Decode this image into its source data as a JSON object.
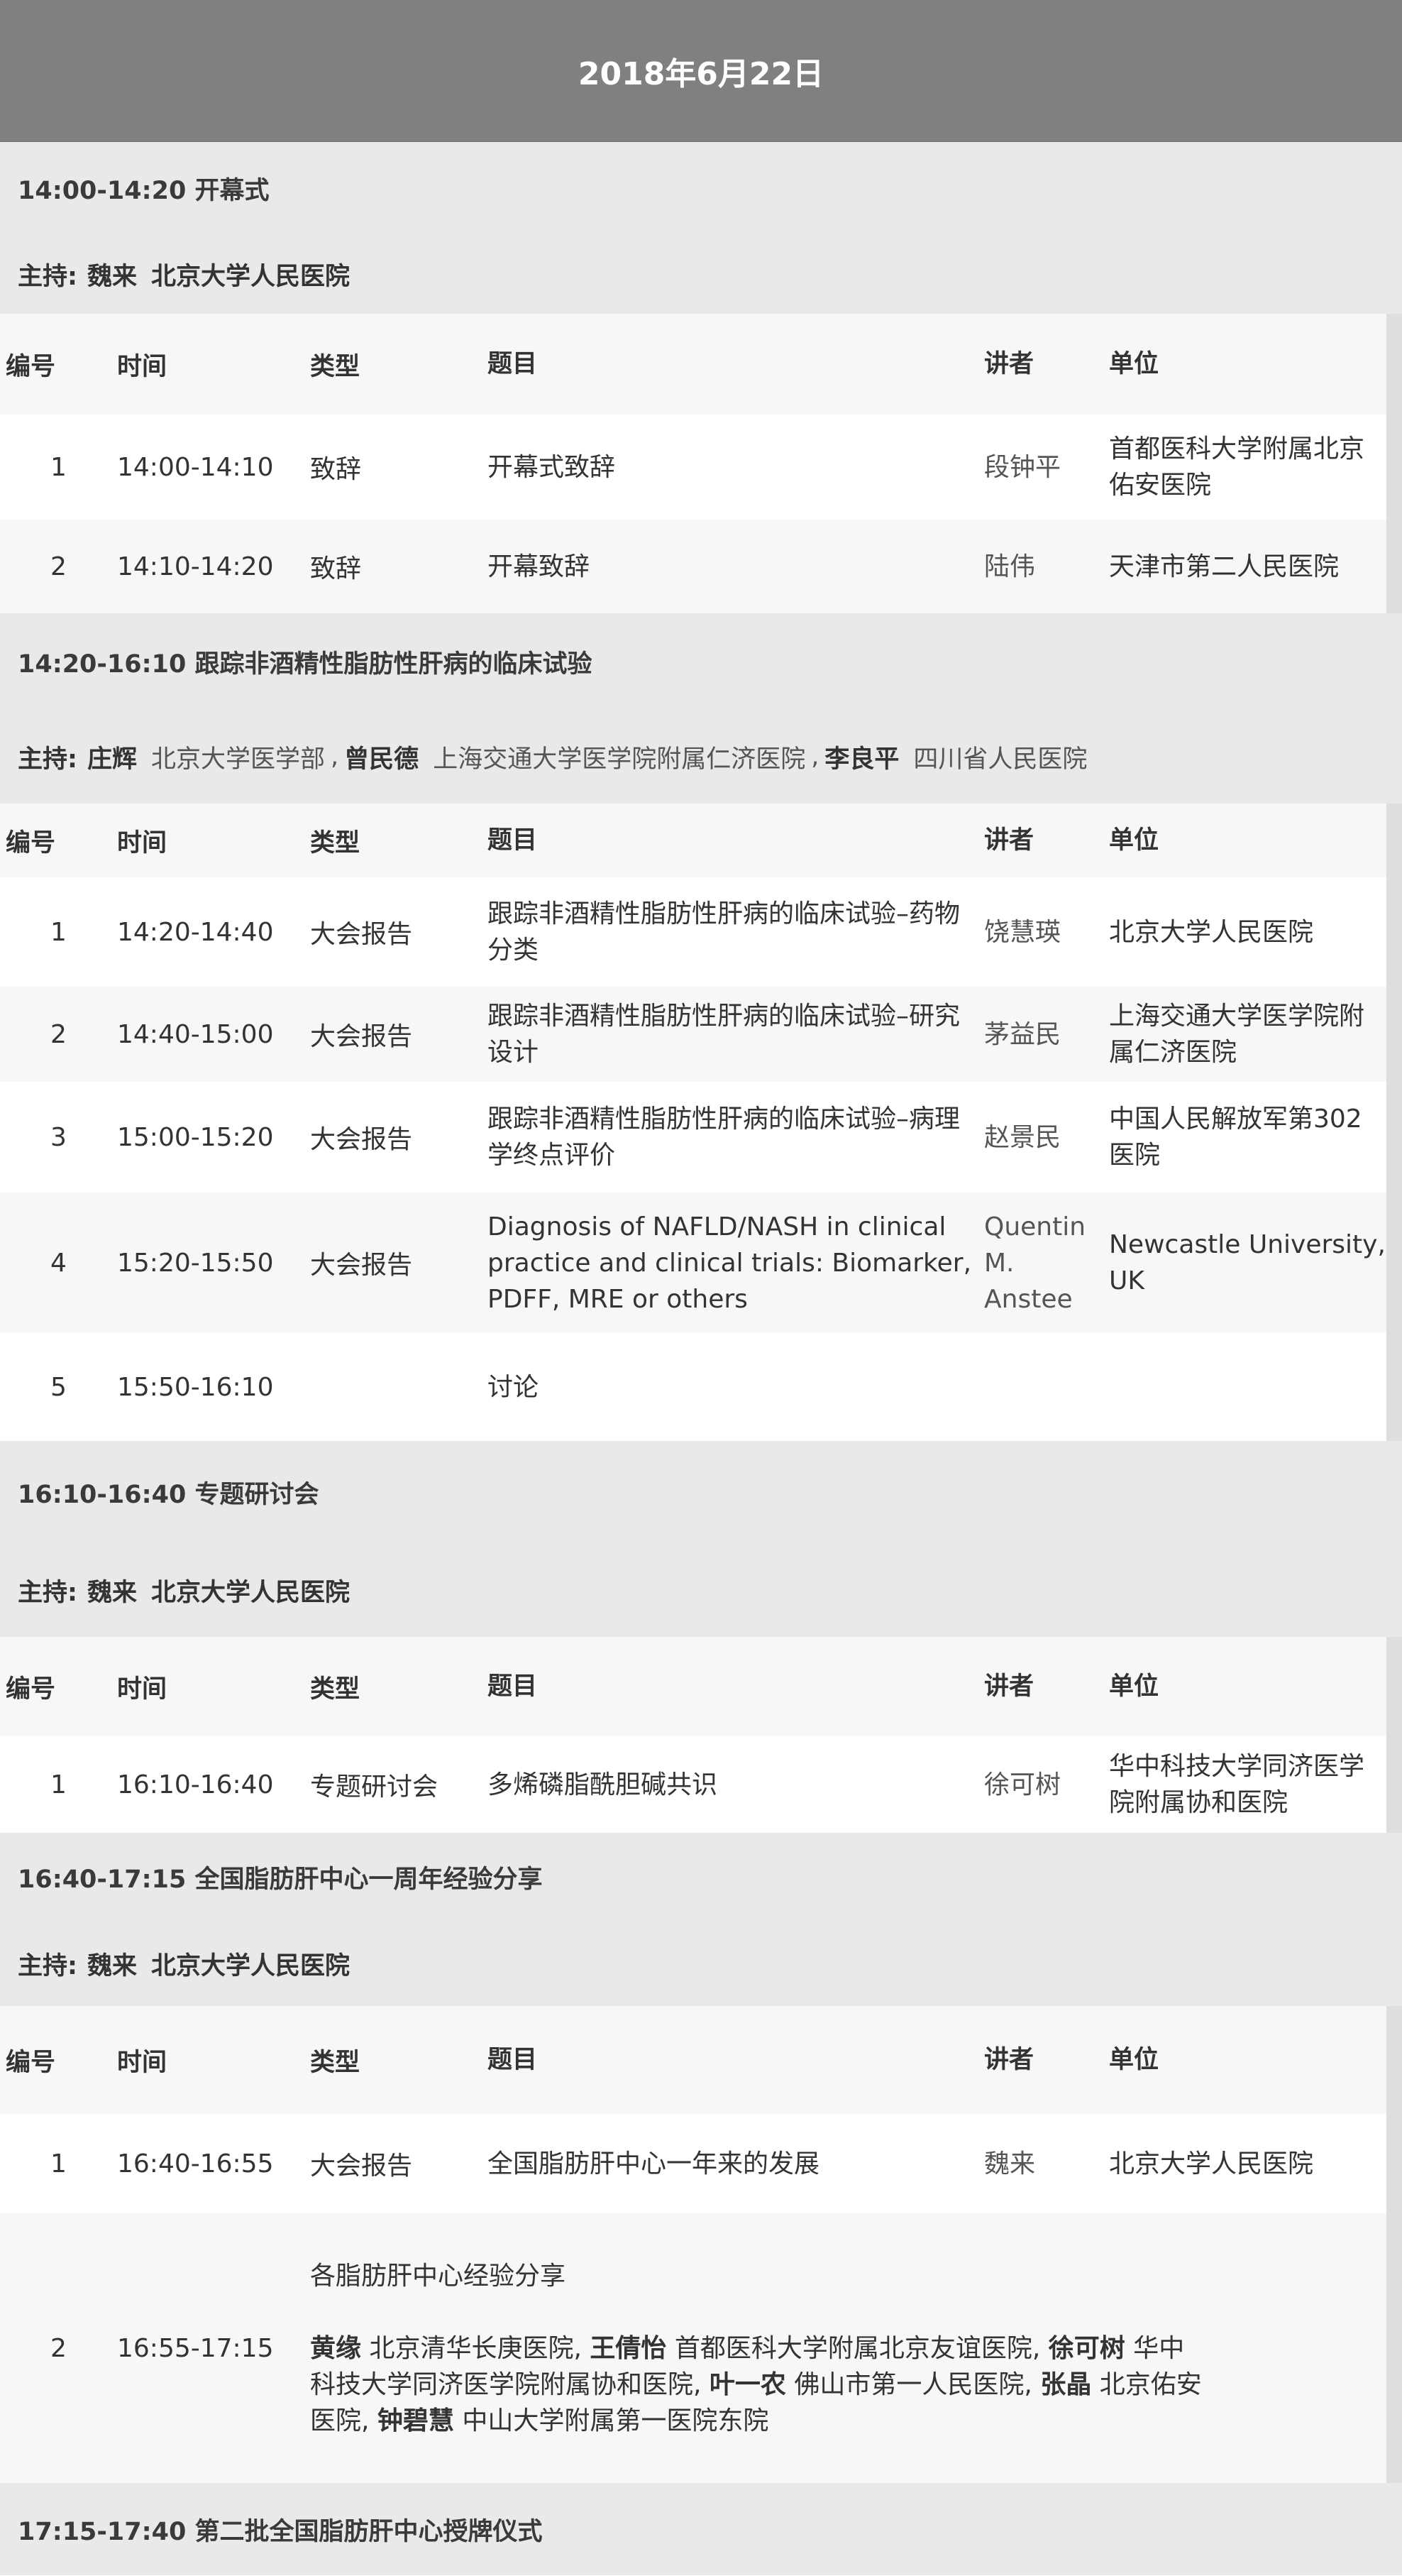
{
  "header": {
    "date": "2018年6月22日"
  },
  "columns": {
    "no": "编号",
    "time": "时间",
    "type": "类型",
    "title": "题目",
    "speaker": "讲者",
    "unit": "单位"
  },
  "sessions": [
    {
      "heading": "14:00-14:20 开幕式",
      "host_prefix": "主持:",
      "hosts": [
        {
          "name": "魏来",
          "unit": "北京大学人民医院"
        }
      ],
      "rows": [
        {
          "no": "1",
          "time": "14:00-14:10",
          "type": "致辞",
          "title": "开幕式致辞",
          "speaker": "段钟平",
          "unit": "首都医科大学附属北京佑安医院"
        },
        {
          "no": "2",
          "time": "14:10-14:20",
          "type": "致辞",
          "title": "开幕致辞",
          "speaker": "陆伟",
          "unit": "天津市第二人民医院"
        }
      ]
    },
    {
      "heading": "14:20-16:10 跟踪非酒精性脂肪性肝病的临床试验",
      "host_prefix": "主持:",
      "hosts": [
        {
          "name": "庄辉",
          "unit": "北京大学医学部"
        },
        {
          "name": "曾民德",
          "unit": "上海交通大学医学院附属仁济医院"
        },
        {
          "name": "李良平",
          "unit": "四川省人民医院"
        }
      ],
      "host_separator": ",",
      "rows": [
        {
          "no": "1",
          "time": "14:20-14:40",
          "type": "大会报告",
          "title": "跟踪非酒精性脂肪性肝病的临床试验–药物分类",
          "speaker": "饶慧瑛",
          "unit": "北京大学人民医院"
        },
        {
          "no": "2",
          "time": "14:40-15:00",
          "type": "大会报告",
          "title": "跟踪非酒精性脂肪性肝病的临床试验–研究设计",
          "speaker": "茅益民",
          "unit": "上海交通大学医学院附属仁济医院"
        },
        {
          "no": "3",
          "time": "15:00-15:20",
          "type": "大会报告",
          "title": "跟踪非酒精性脂肪性肝病的临床试验–病理学终点评价",
          "speaker": "赵景民",
          "unit": "中国人民解放军第302医院"
        },
        {
          "no": "4",
          "time": "15:20-15:50",
          "type": "大会报告",
          "title": "Diagnosis of NAFLD/NASH in clinical practice and clinical trials: Biomarker, PDFF, MRE or others",
          "speaker": "Quentin M. Anstee",
          "unit": "Newcastle University, UK"
        },
        {
          "no": "5",
          "time": "15:50-16:10",
          "type": "",
          "title": "讨论",
          "speaker": "",
          "unit": ""
        }
      ]
    },
    {
      "heading": "16:10-16:40 专题研讨会",
      "host_prefix": "主持:",
      "hosts": [
        {
          "name": "魏来",
          "unit": "北京大学人民医院"
        }
      ],
      "rows": [
        {
          "no": "1",
          "time": "16:10-16:40",
          "type": "专题研讨会",
          "title": "多烯磷脂酰胆碱共识",
          "speaker": "徐可树",
          "unit": "华中科技大学同济医学院附属协和医院"
        }
      ]
    },
    {
      "heading": "16:40-17:15 全国脂肪肝中心一周年经验分享",
      "host_prefix": "主持:",
      "hosts": [
        {
          "name": "魏来",
          "unit": "北京大学人民医院"
        }
      ],
      "rows": [
        {
          "no": "1",
          "time": "16:40-16:55",
          "type": "大会报告",
          "title": "全国脂肪肝中心一年来的发展",
          "speaker": "魏来",
          "unit": "北京大学人民医院"
        },
        {
          "no": "2",
          "time": "16:55-17:15",
          "title": "各脂肪肝中心经验分享",
          "participants": [
            {
              "name": "黄缘",
              "unit": "北京清华长庚医院"
            },
            {
              "name": "王倩怡",
              "unit": "首都医科大学附属北京友谊医院"
            },
            {
              "name": "徐可树",
              "unit": "华中科技大学同济医学院附属协和医院"
            },
            {
              "name": "叶一农",
              "unit": "佛山市第一人民医院"
            },
            {
              "name": "张晶",
              "unit": "北京佑安医院"
            },
            {
              "name": "钟碧慧",
              "unit": "中山大学附属第一医院东院"
            }
          ],
          "participant_separator": ","
        }
      ]
    },
    {
      "heading": "17:15-17:40 第二批全国脂肪肝中心授牌仪式"
    }
  ]
}
